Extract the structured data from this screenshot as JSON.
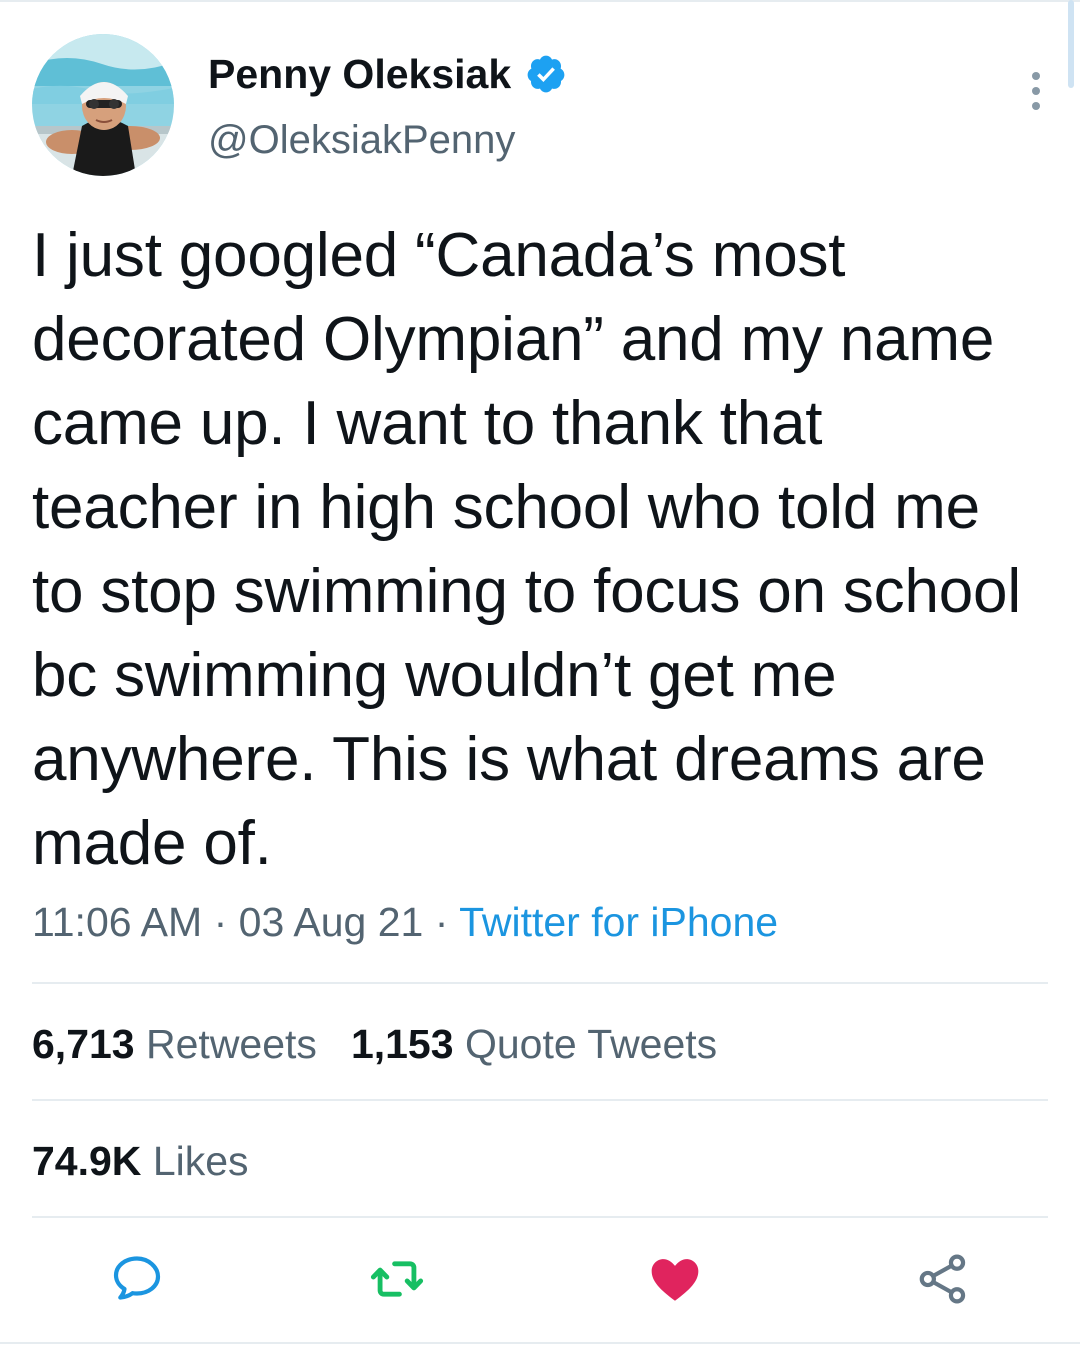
{
  "author": {
    "display_name": "Penny Oleksiak",
    "handle": "@OleksiakPenny",
    "verified": true,
    "avatar": "swimmer-avatar"
  },
  "tweet": {
    "text": "I just googled “Canada’s most decorated Olympian” and my name came up. I want to thank that teacher in high school who told me to stop swimming to focus on school bc swimming wouldn’t get me anywhere. This is what dreams are made of.",
    "time": "11:06 AM",
    "date": "03 Aug 21",
    "separator": "·",
    "source": "Twitter for iPhone"
  },
  "stats": {
    "retweets_count": "6,713",
    "retweets_label": "Retweets",
    "quote_count": "1,153",
    "quote_label": "Quote Tweets",
    "likes_count": "74.9K",
    "likes_label": "Likes"
  },
  "actions": [
    {
      "name": "reply",
      "icon": "speech-bubble-icon"
    },
    {
      "name": "retweet",
      "icon": "retweet-icon"
    },
    {
      "name": "like",
      "icon": "heart-icon",
      "active": true
    },
    {
      "name": "share",
      "icon": "share-icon"
    }
  ],
  "colors": {
    "accent": "#1b95e0",
    "retweet": "#17bf63",
    "like": "#e0245e",
    "text": "#0f1419",
    "secondary": "#536471",
    "divider": "#e6ecf0"
  }
}
